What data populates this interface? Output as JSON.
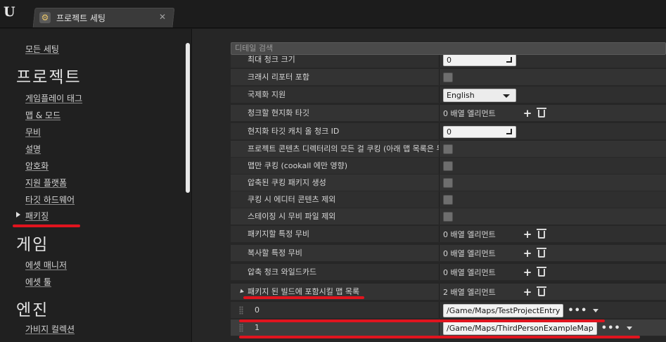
{
  "window": {
    "tab_title": "프로젝트 세팅",
    "close_glyph": "✕",
    "logo_glyph": "U"
  },
  "sidebar": {
    "all_settings": "모든 세팅",
    "section_project": "프로젝트",
    "project_items": [
      "게임플레이 태그",
      "맵 & 모드",
      "무비",
      "설명",
      "암호화",
      "지원 플랫폼",
      "타깃 하드웨어",
      "패키징"
    ],
    "section_game": "게임",
    "game_items": [
      "에셋 매니저",
      "에셋 툴"
    ],
    "section_engine": "엔진",
    "engine_items": [
      "가비지 컬렉션"
    ]
  },
  "details": {
    "search_placeholder": "디테일 검색",
    "rows": [
      {
        "label": "최대 청크 크기",
        "type": "number",
        "value": "0"
      },
      {
        "label": "크래시 리포터 포함",
        "type": "checkbox"
      },
      {
        "label": "국제화 지원",
        "type": "dropdown",
        "value": "English"
      },
      {
        "label": "청크할 현지화 타깃",
        "type": "array",
        "value": "0 배열 엘리먼트"
      },
      {
        "label": "현지화 타깃 캐치 올 청크 ID",
        "type": "number",
        "value": "0"
      },
      {
        "label": "프로젝트 콘텐츠 디렉터리의 모든 걸 쿠킹 (아래 맵 목록은 무",
        "type": "checkbox"
      },
      {
        "label": "맵만 쿠킹 (cookall 에만 영향)",
        "type": "checkbox"
      },
      {
        "label": "압축된 쿠킹 패키지 생성",
        "type": "checkbox"
      },
      {
        "label": "쿠킹 시 에디터 콘텐츠 제외",
        "type": "checkbox"
      },
      {
        "label": "스테이징 시 무비 파일 제외",
        "type": "checkbox"
      },
      {
        "label": "패키지할 특정 무비",
        "type": "array",
        "value": "0 배열 엘리먼트"
      },
      {
        "label": "복사할 특정 무비",
        "type": "array",
        "value": "0 배열 엘리먼트"
      },
      {
        "label": "압축 청크 와일드카드",
        "type": "array",
        "value": "0 배열 엘리먼트"
      },
      {
        "label": "패키지 된 빌드에 포함시킬 맵 목록",
        "type": "array",
        "value": "2 배열 엘리먼트",
        "expanded": true
      }
    ],
    "map_entries": [
      {
        "index": "0",
        "path": "/Game/Maps/TestProjectEntry"
      },
      {
        "index": "1",
        "path": "/Game/Maps/ThirdPersonExampleMap"
      }
    ],
    "more_glyph": "•••",
    "plus_glyph": "+"
  },
  "colors": {
    "annotation_red": "#e0141e",
    "panel_bg": "#262626",
    "row_bg": "#2f2f2f"
  }
}
